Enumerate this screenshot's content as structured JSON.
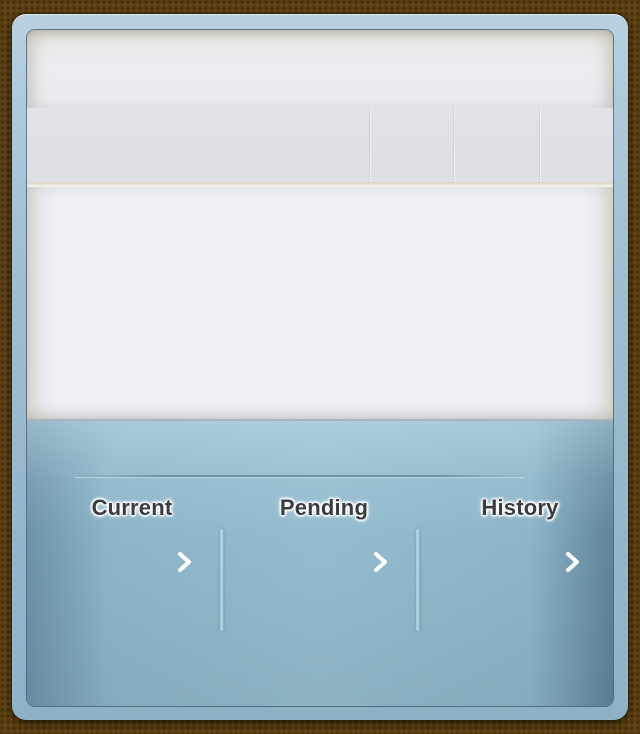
{
  "nav": {
    "items": [
      {
        "label": "Current",
        "icon": "chevron-right-icon"
      },
      {
        "label": "Pending",
        "icon": "chevron-right-icon"
      },
      {
        "label": "History",
        "icon": "chevron-right-icon"
      }
    ]
  },
  "colors": {
    "background_leather": "#5a3f12",
    "frame_blue": "#9dbdd0",
    "panel_blue": "#8db5c9",
    "label_text": "#3a3d40"
  }
}
